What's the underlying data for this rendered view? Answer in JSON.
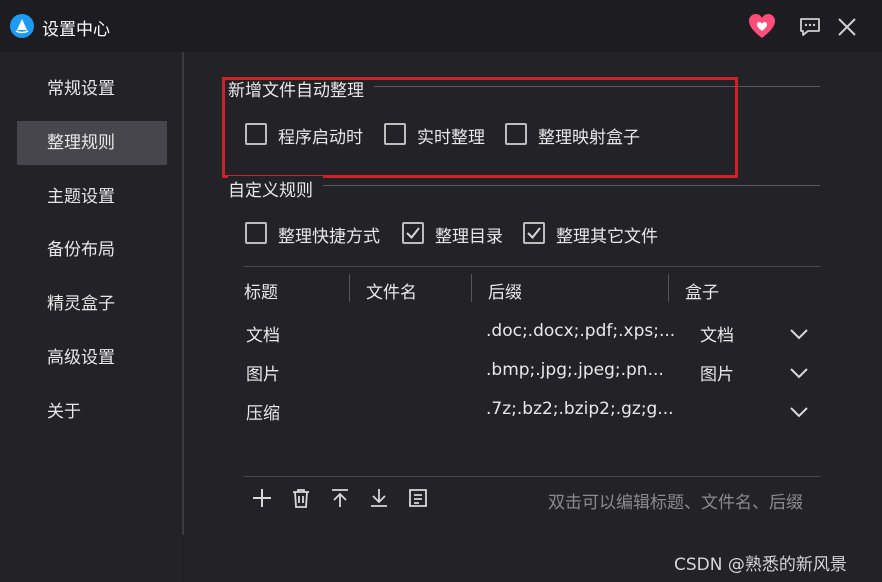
{
  "window": {
    "title": "设置中心",
    "accent_color": "#1d9bf0",
    "heart_color": "#ff4d7a",
    "highlight_color": "#d0202a"
  },
  "titlebar_icons": [
    "app-logo-icon",
    "heart-icon",
    "chat-feedback-icon",
    "close-icon"
  ],
  "sidebar": {
    "items": [
      {
        "label": "常规设置",
        "active": false
      },
      {
        "label": "整理规则",
        "active": true
      },
      {
        "label": "主题设置",
        "active": false
      },
      {
        "label": "备份布局",
        "active": false
      },
      {
        "label": "精灵盒子",
        "active": false
      },
      {
        "label": "高级设置",
        "active": false
      },
      {
        "label": "关于",
        "active": false
      }
    ]
  },
  "auto_organize": {
    "title": "新增文件自动整理",
    "options": [
      {
        "label": "程序启动时",
        "checked": false
      },
      {
        "label": "实时整理",
        "checked": false
      },
      {
        "label": "整理映射盒子",
        "checked": false
      }
    ]
  },
  "custom_rules": {
    "title": "自定义规则",
    "options": [
      {
        "label": "整理快捷方式",
        "checked": false
      },
      {
        "label": "整理目录",
        "checked": true
      },
      {
        "label": "整理其它文件",
        "checked": true
      }
    ]
  },
  "table": {
    "columns": [
      "标题",
      "文件名",
      "后缀",
      "盒子"
    ],
    "rows": [
      {
        "title": "文档",
        "filename": "",
        "suffix": ".doc;.docx;.pdf;.xps;...",
        "box": "文档"
      },
      {
        "title": "图片",
        "filename": "",
        "suffix": ".bmp;.jpg;.jpeg;.pn...",
        "box": "图片"
      },
      {
        "title": "压缩",
        "filename": "",
        "suffix": ".7z;.bz2;.bzip2;.gz;g...",
        "box": ""
      }
    ]
  },
  "toolbar": {
    "icons": [
      "add-icon",
      "delete-icon",
      "move-top-icon",
      "download-icon",
      "notes-icon"
    ],
    "hint": "双击可以编辑标题、文件名、后缀"
  },
  "watermark": "CSDN @熟悉的新风景"
}
